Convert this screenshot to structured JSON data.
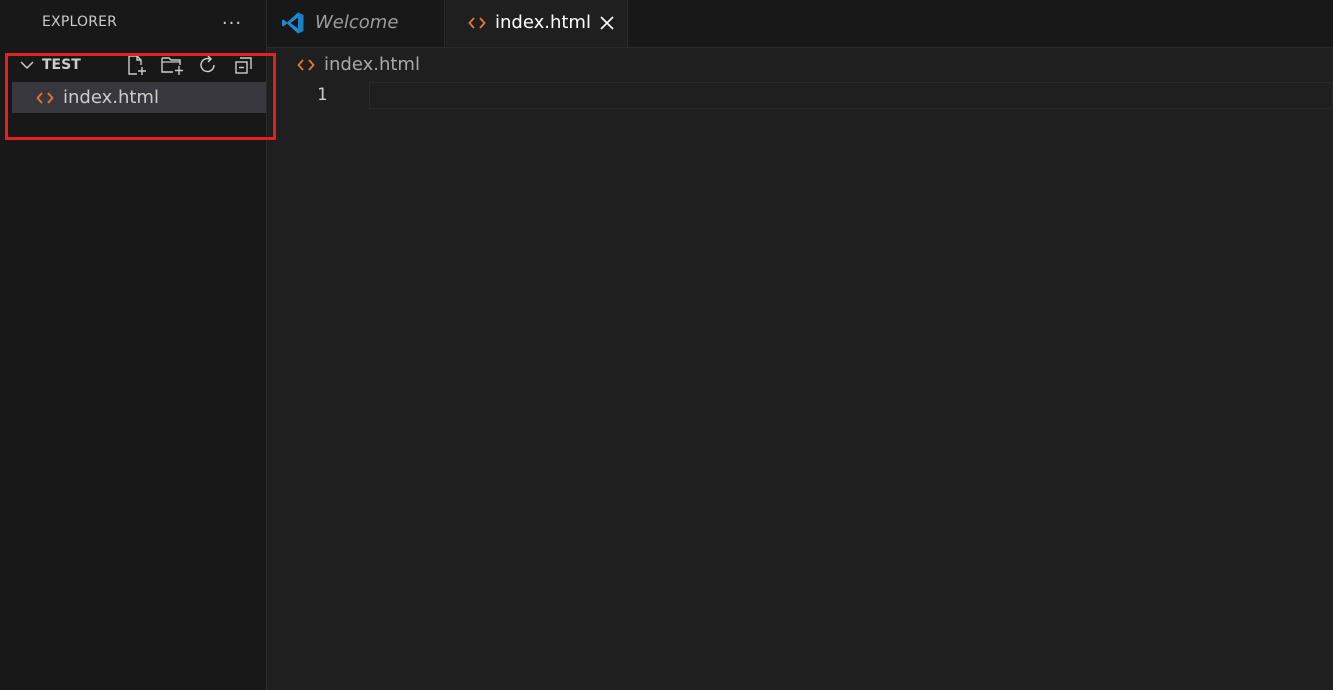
{
  "sidebar": {
    "title": "EXPLORER",
    "more_label": "···",
    "section": {
      "title": "TEST",
      "actions": [
        "new-file-icon",
        "new-folder-icon",
        "refresh-icon",
        "collapse-all-icon"
      ]
    },
    "files": [
      {
        "label": "index.html",
        "icon": "html-file-icon"
      }
    ]
  },
  "tabs": [
    {
      "label": "Welcome",
      "icon": "vscode-logo-icon",
      "active": false,
      "italic": true
    },
    {
      "label": "index.html",
      "icon": "html-file-icon",
      "active": true,
      "closable": true
    }
  ],
  "breadcrumb": {
    "label": "index.html",
    "icon": "html-file-icon"
  },
  "editor": {
    "line_numbers": [
      "1"
    ]
  },
  "colors": {
    "background": "#1f1f1f",
    "sidebar": "#181818",
    "selected_row": "#37373d",
    "html_icon": "#e37933",
    "highlight_box": "#e32121",
    "vscode_blue": "#2489ca"
  }
}
